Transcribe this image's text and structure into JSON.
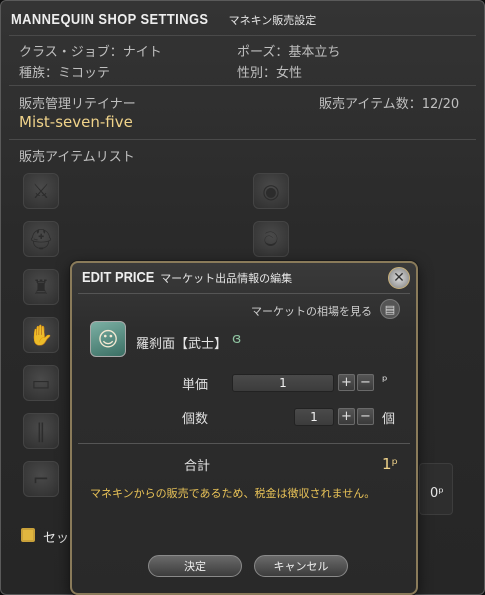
{
  "window": {
    "title": "MANNEQUIN SHOP SETTINGS",
    "subtitle": "マネキン販売設定"
  },
  "info": {
    "class_job": "クラス・ジョブ：ナイト",
    "pose": "ポーズ：基本立ち",
    "race": "種族：ミコッテ",
    "gender": "性別：女性",
    "retainer_label": "販売管理リテイナー",
    "item_count_label": "販売アイテム数：12/20",
    "retainer_name": "Mist-seven-five",
    "item_list_label": "販売アイテムリスト"
  },
  "slots": {
    "left": [
      "sword-icon",
      "hat-icon",
      "body-icon",
      "hand-icon",
      "belt-icon",
      "legs-icon",
      "feet-icon"
    ],
    "right": [
      "earring-icon",
      "necklace-icon"
    ]
  },
  "footer": {
    "checkbox_label": "セッ",
    "right_price": "0ᵖ"
  },
  "modal": {
    "title": "EDIT PRICE",
    "subtitle": "マーケット出品情報の編集",
    "close_icon": "close-icon",
    "market_link": "マーケットの相場を見る",
    "item_name": "羅刹面【武士】",
    "unit_price_label": "単価",
    "unit_price_value": "1",
    "unit_price_unit": "ᵖ",
    "quantity_label": "個数",
    "quantity_value": "1",
    "quantity_unit": "個",
    "total_label": "合計",
    "total_value": "1ᵖ",
    "note": "マネキンからの販売であるため、税金は徴収されません。",
    "confirm_label": "決定",
    "cancel_label": "キャンセル"
  },
  "colors": {
    "gold": "#f0d38a",
    "note_yellow": "#e8c257",
    "modal_border": "#8a7b5a"
  }
}
